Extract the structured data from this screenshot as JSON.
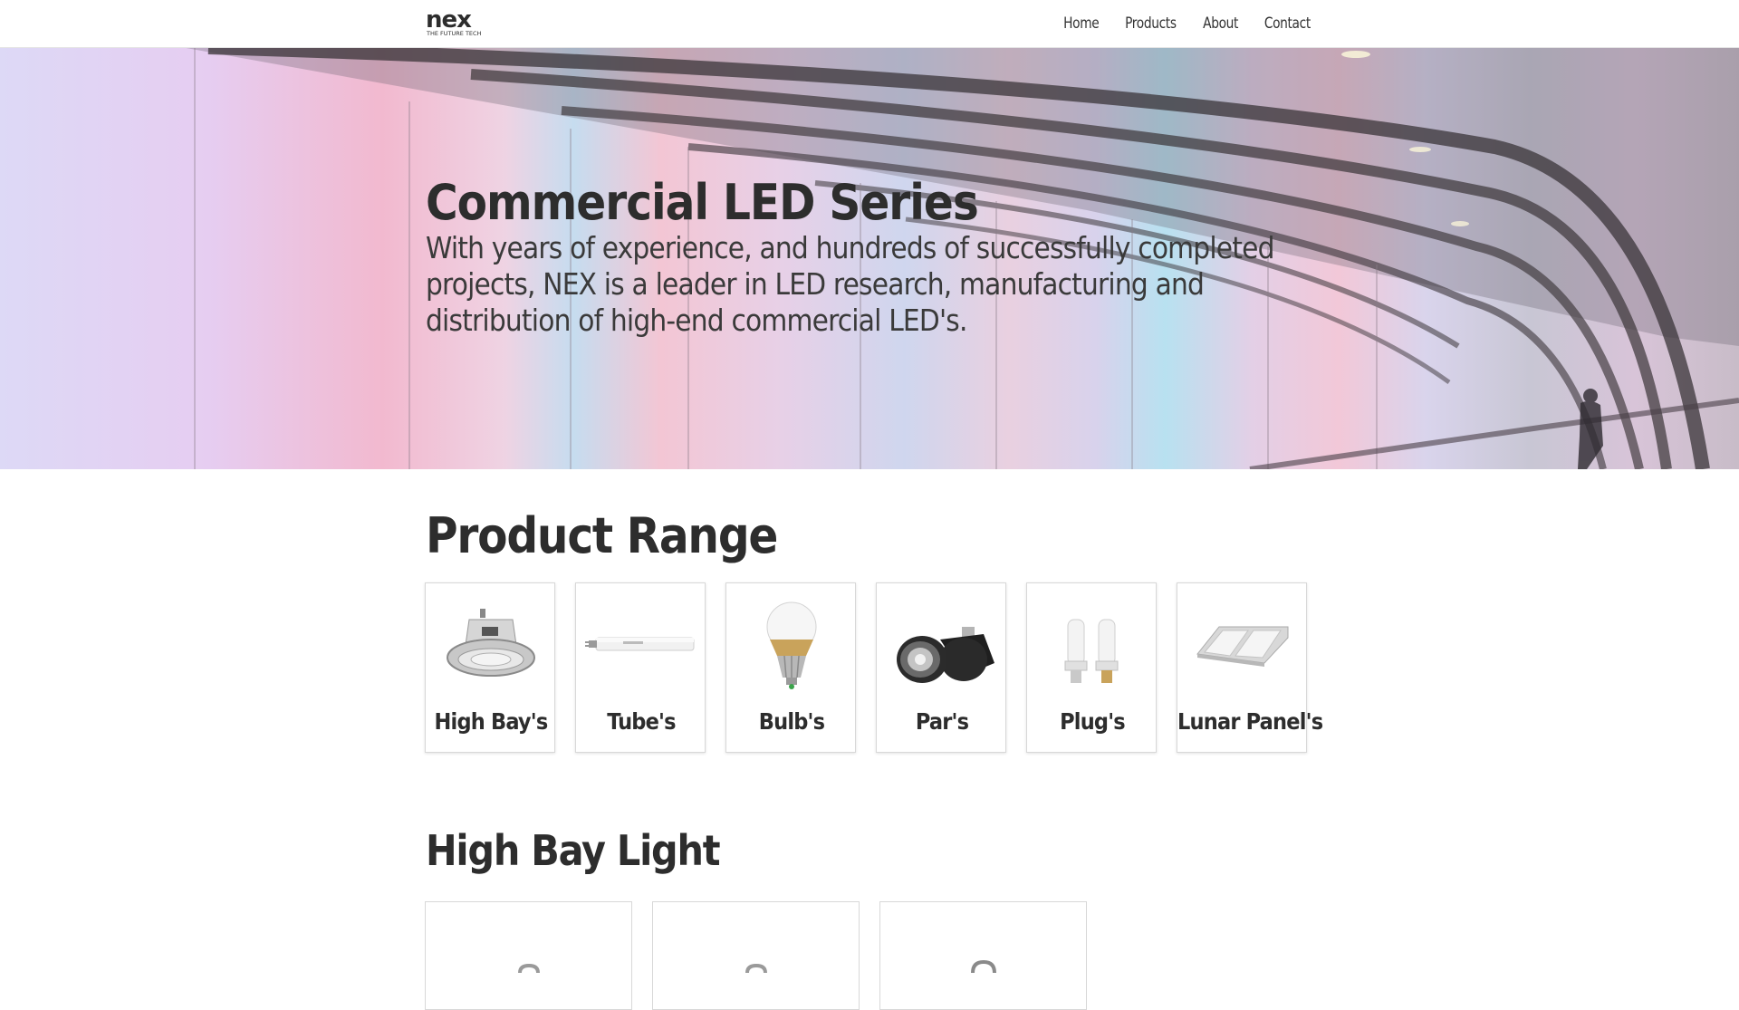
{
  "navbar": {
    "logo_text": "nex",
    "logo_tagline": "THE FUTURE TECH",
    "links": [
      {
        "label": "Home"
      },
      {
        "label": "Products"
      },
      {
        "label": "About"
      },
      {
        "label": "Contact"
      }
    ]
  },
  "hero": {
    "title": "Commercial LED Series",
    "subtitle": "With years of experience, and hundreds of successfully completed projects, NEX is a leader in LED research, manufacturing and distribution of high-end commercial LED's."
  },
  "product_range": {
    "title": "Product Range",
    "items": [
      {
        "label": "High Bay's",
        "icon": "high-bay-light-icon"
      },
      {
        "label": "Tube's",
        "icon": "led-tube-icon"
      },
      {
        "label": "Bulb's",
        "icon": "led-bulb-icon"
      },
      {
        "label": "Par's",
        "icon": "par-lamp-icon"
      },
      {
        "label": "Plug's",
        "icon": "plug-lamp-icon"
      },
      {
        "label": "Lunar Panel's",
        "icon": "lunar-panel-icon"
      }
    ]
  },
  "high_bay": {
    "title": "High Bay Light"
  },
  "colors": {
    "text": "#333333",
    "card_border": "#d8d8d8",
    "nav_background": "#ffffff"
  }
}
